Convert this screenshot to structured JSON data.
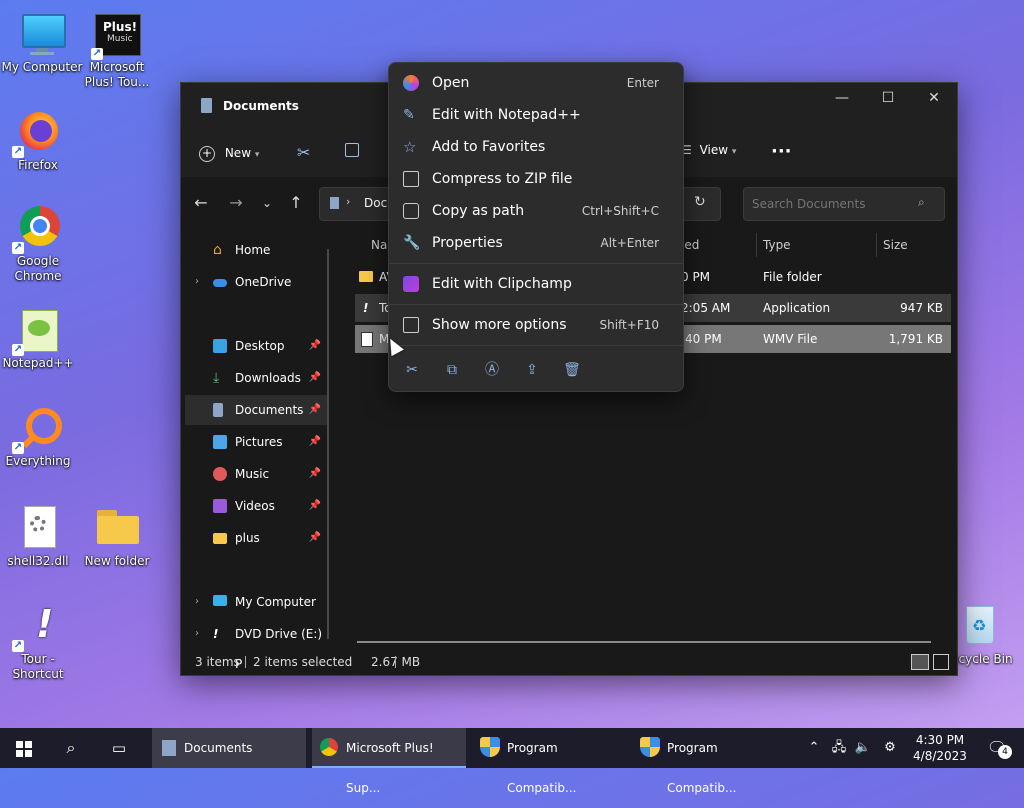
{
  "desktop": {
    "icons": [
      {
        "label": "My Computer"
      },
      {
        "label": "Microsoft Plus! Tou..."
      },
      {
        "label": "Firefox"
      },
      {
        "label": "Google Chrome"
      },
      {
        "label": "Notepad++"
      },
      {
        "label": "Everything"
      },
      {
        "label": "shell32.dll"
      },
      {
        "label": "New folder"
      },
      {
        "label": "Tour - Shortcut"
      },
      {
        "label": "Recycle Bin"
      }
    ],
    "plus_logo_text": "Plus!",
    "plus_logo_sub": "Music"
  },
  "window": {
    "title": "Documents",
    "controls": {
      "minimize": "—",
      "maximize": "☐",
      "close": "✕"
    },
    "toolbar": {
      "new_label": "New",
      "view_label": "View",
      "more": "···"
    },
    "address": {
      "path_text": "Docu"
    },
    "search": {
      "placeholder": "Search Documents"
    },
    "sidebar": [
      {
        "label": "Home"
      },
      {
        "label": "OneDrive"
      },
      {
        "label": "Desktop"
      },
      {
        "label": "Downloads"
      },
      {
        "label": "Documents"
      },
      {
        "label": "Pictures"
      },
      {
        "label": "Music"
      },
      {
        "label": "Videos"
      },
      {
        "label": "plus"
      },
      {
        "label": "My Computer"
      },
      {
        "label": "DVD Drive (E:) P"
      }
    ],
    "columns": {
      "name": "Nar",
      "modified": "ied",
      "type": "Type",
      "size": "Size"
    },
    "rows": [
      {
        "name": "AV",
        "modified": "0 PM",
        "type": "File folder",
        "size": ""
      },
      {
        "name": "To",
        "modified": "2:05 AM",
        "type": "Application",
        "size": "947 KB"
      },
      {
        "name": "M",
        "modified": ":40 PM",
        "type": "WMV File",
        "size": "1,791 KB"
      }
    ],
    "status": {
      "items": "3 items",
      "selected": "2 items selected",
      "size": "2.67 MB"
    }
  },
  "context_menu": {
    "items": [
      {
        "label": "Open",
        "shortcut": "Enter"
      },
      {
        "label": "Edit with Notepad++",
        "shortcut": ""
      },
      {
        "label": "Add to Favorites",
        "shortcut": ""
      },
      {
        "label": "Compress to ZIP file",
        "shortcut": ""
      },
      {
        "label": "Copy as path",
        "shortcut": "Ctrl+Shift+C"
      },
      {
        "label": "Properties",
        "shortcut": "Alt+Enter"
      },
      {
        "label": "Edit with Clipchamp",
        "shortcut": ""
      },
      {
        "label": "Show more options",
        "shortcut": "Shift+F10"
      }
    ]
  },
  "taskbar": {
    "apps": [
      {
        "label": "Documents"
      },
      {
        "label": "Microsoft Plus! Sup..."
      },
      {
        "label": "Program Compatib..."
      },
      {
        "label": "Program Compatib..."
      }
    ],
    "time": "4:30 PM",
    "date": "4/8/2023",
    "notification_count": "4"
  },
  "colors": {
    "accent": "#7ab0ff",
    "folder": "#f6c94a",
    "window_bg": "#191919",
    "menu_bg": "#2c2c2c"
  }
}
